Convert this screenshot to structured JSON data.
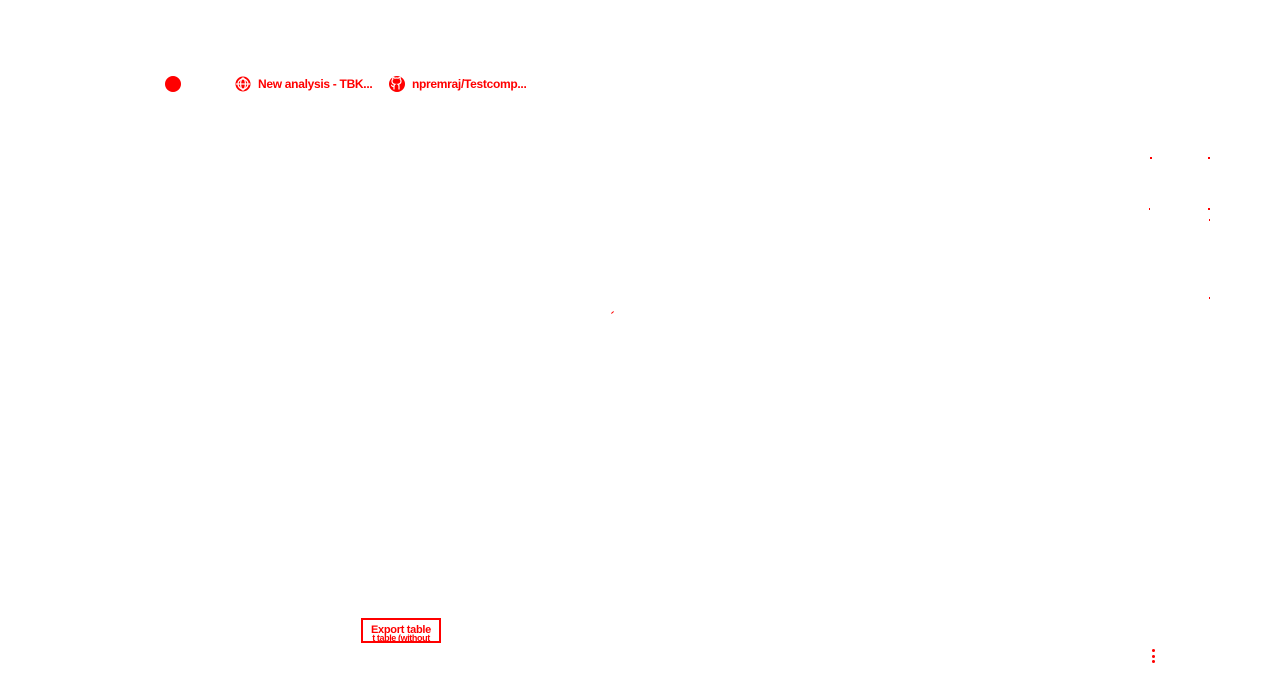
{
  "tabs": [
    {
      "label": "New analysis - TBK...",
      "icon": "globe-icon"
    },
    {
      "label": "npremraj/Testcomp...",
      "icon": "github-icon"
    }
  ],
  "app": {
    "indicator_icon": "record-dot-icon"
  },
  "table": {
    "export_button_label": "Export table",
    "export_button_secondary": "t table (without"
  },
  "menu": {
    "icon": "kebab-menu-icon"
  },
  "colors": {
    "accent": "#ff0000",
    "background": "#ffffff"
  }
}
